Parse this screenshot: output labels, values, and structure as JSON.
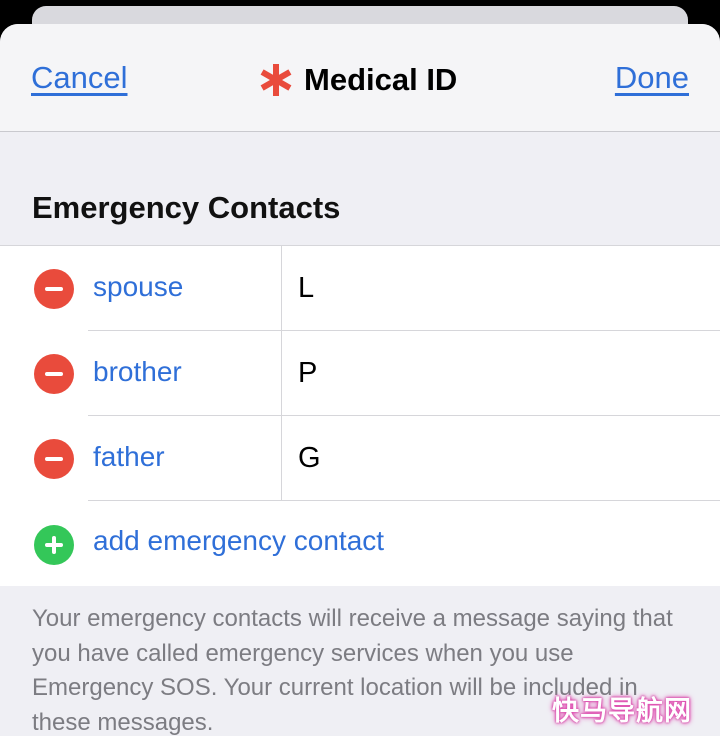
{
  "nav": {
    "cancel_label": "Cancel",
    "title": "Medical ID",
    "done_label": "Done"
  },
  "section": {
    "title": "Emergency Contacts"
  },
  "contacts": [
    {
      "relationship": "spouse",
      "name": "L"
    },
    {
      "relationship": "brother",
      "name": "P"
    },
    {
      "relationship": "father",
      "name": "G"
    }
  ],
  "add_contact_label": "add emergency contact",
  "footer_text": "Your emergency contacts will receive a message saying that you have called emergency services when you use Emergency SOS. Your current location will be included in these messages.",
  "watermark": "快马导航网",
  "colors": {
    "accent": "#2f6fd8",
    "remove": "#e94b3c",
    "add": "#34c759",
    "medical_asterisk": "#e94b3c"
  },
  "icons": {
    "title_icon": "medical-asterisk-icon",
    "remove_icon": "minus-circle-icon",
    "add_icon": "plus-circle-icon"
  }
}
